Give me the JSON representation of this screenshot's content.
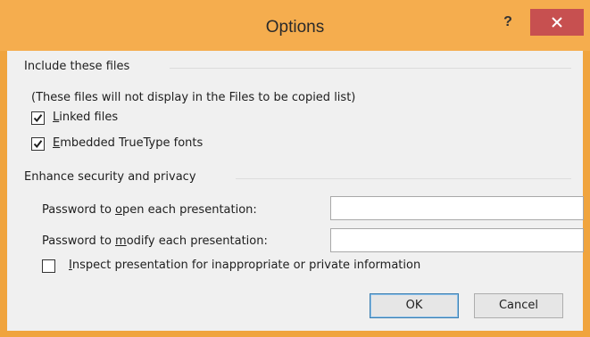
{
  "window": {
    "title": "Options",
    "help_label": "?",
    "close_icon": "close-icon"
  },
  "include_files": {
    "header": "Include these files",
    "note": "(These files will not display in the Files to be copied list)",
    "linked_files": {
      "accel": "L",
      "rest": "inked files",
      "checked": true
    },
    "embedded_fonts": {
      "accel": "E",
      "rest": "mbedded TrueType fonts",
      "checked": true
    }
  },
  "security": {
    "header": "Enhance security and privacy",
    "open_password": {
      "pre": "Password to ",
      "accel": "o",
      "post": "pen each presentation:",
      "value": ""
    },
    "modify_password": {
      "pre": "Password to ",
      "accel": "m",
      "post": "odify each presentation:",
      "value": ""
    },
    "inspect": {
      "accel": "I",
      "rest": "nspect presentation for inappropriate or private information",
      "checked": false
    }
  },
  "buttons": {
    "ok": "OK",
    "cancel": "Cancel"
  },
  "colors": {
    "titlebar": "#f5ad4e",
    "close_button": "#c75050",
    "dialog_background": "#f0f0f0"
  }
}
